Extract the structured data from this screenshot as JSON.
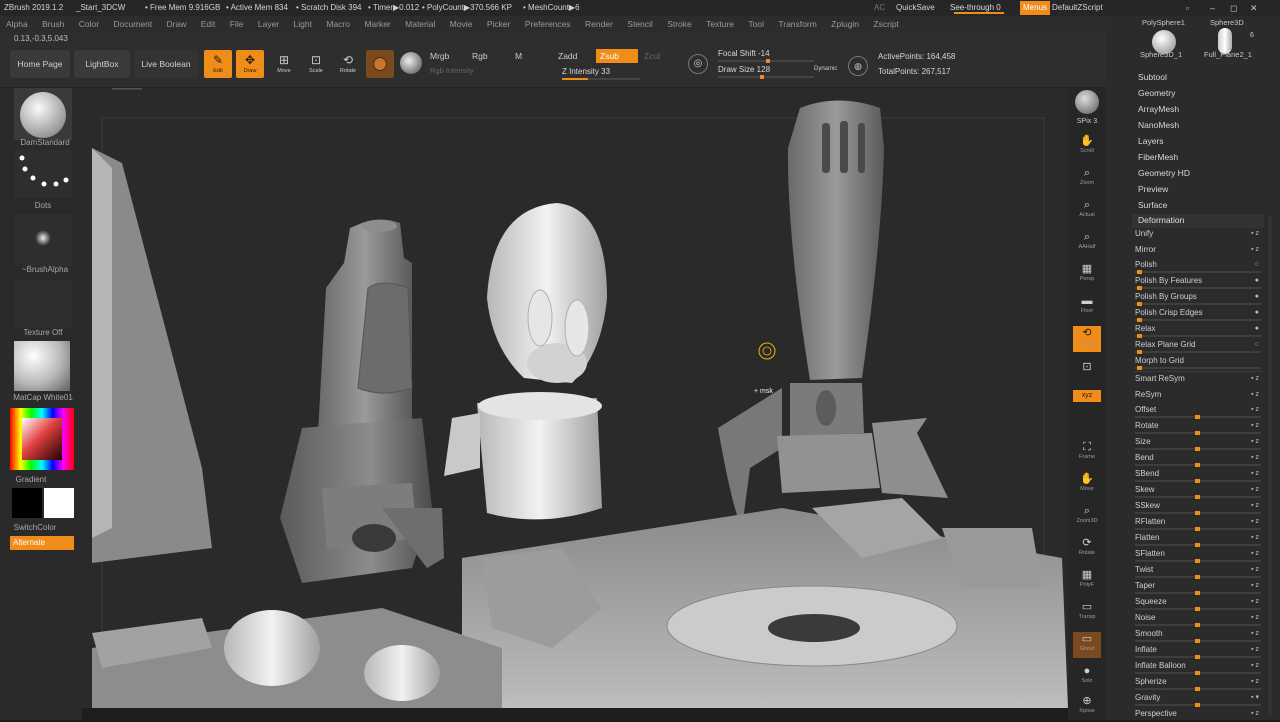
{
  "titlebar": {
    "app": "ZBrush 2019.1.2",
    "doc": "_Start_3DCW",
    "free_mem": "• Free Mem 9.916GB",
    "active_mem": "• Active Mem 834",
    "scratch": "• Scratch Disk 394",
    "timer": "• Timer▶0.012",
    "polycount": "• PolyCount▶370.566 KP",
    "meshcount": "• MeshCount▶6",
    "ac": "AC",
    "quicksave": "QuickSave",
    "seethrough": "See-through  0",
    "menus": "Menus",
    "script": "DefaultZScript"
  },
  "menus": [
    "Alpha",
    "Brush",
    "Color",
    "Document",
    "Draw",
    "Edit",
    "File",
    "Layer",
    "Light",
    "Macro",
    "Marker",
    "Material",
    "Movie",
    "Picker",
    "Preferences",
    "Render",
    "Stencil",
    "Stroke",
    "Texture",
    "Tool",
    "Transform",
    "Zplugin",
    "Zscript"
  ],
  "coords": "0.13,-0.3,5.043",
  "toolbar": {
    "home": "Home Page",
    "lightbox": "LightBox",
    "live_boolean": "Live Boolean",
    "edit": "Edit",
    "draw": "Draw",
    "move": "Move",
    "scale": "Scale",
    "rotate": "Rotate",
    "mrgb": "Mrgb",
    "rgb": "Rgb",
    "m": "M",
    "rgb_intensity": "Rgb Intensity",
    "zadd": "Zadd",
    "zsub": "Zsub",
    "zcut": "Zcut",
    "z_intensity": "Z Intensity 33",
    "z_intensity_value": 0.33,
    "focal_shift": "Focal Shift -14",
    "draw_size": "Draw Size 128",
    "dynamic": "Dynamic",
    "active_points": "ActivePoints: 164,458",
    "total_points": "TotalPoints: 267,517"
  },
  "leftshelf": {
    "brush": "DamStandard",
    "stroke": "Dots",
    "alpha": "~BrushAlpha",
    "texture": "Texture Off",
    "material": "MatCap White01",
    "gradient": "Gradient",
    "switchcolor": "SwitchColor",
    "alternate": "Alternate"
  },
  "rightshelf": [
    {
      "icon": "bpr-icon",
      "glyph": "BPR",
      "label": ""
    },
    {
      "icon": "spix-icon",
      "glyph": "",
      "label": "SPix 3"
    },
    {
      "icon": "scroll-icon",
      "glyph": "✋",
      "label": "Scroll"
    },
    {
      "icon": "zoom-icon",
      "glyph": "⌕",
      "label": "Zoom"
    },
    {
      "icon": "actual-icon",
      "glyph": "⌕",
      "label": "Actual"
    },
    {
      "icon": "aahalf-icon",
      "glyph": "⌕",
      "label": "AAHalf"
    },
    {
      "icon": "persp-icon",
      "glyph": "▦",
      "label": "Persp"
    },
    {
      "icon": "floor-icon",
      "glyph": "▬",
      "label": "Floor"
    },
    {
      "icon": "local-icon",
      "glyph": "⟲",
      "label": "L.Sym"
    },
    {
      "icon": "lock-icon",
      "glyph": "🔒",
      "label": ""
    },
    {
      "icon": "xyz-icon",
      "glyph": "xyz",
      "label": ""
    },
    {
      "icon": "frame-icon",
      "glyph": "⛶",
      "label": "Frame"
    },
    {
      "icon": "move-icon",
      "glyph": "✋",
      "label": "Move"
    },
    {
      "icon": "zoom3d-icon",
      "glyph": "⌕",
      "label": "Zoom3D"
    },
    {
      "icon": "rotate-icon",
      "glyph": "⟳",
      "label": "Rotate"
    },
    {
      "icon": "polyf-icon",
      "glyph": "▦",
      "label": "PolyF"
    },
    {
      "icon": "transp-icon",
      "glyph": "▭",
      "label": "Transp"
    },
    {
      "icon": "ghost-icon",
      "glyph": "▭",
      "label": "Ghost"
    },
    {
      "icon": "solo-icon",
      "glyph": "●",
      "label": "Solo"
    },
    {
      "icon": "xpose-icon",
      "glyph": "⊕",
      "label": "Xpose"
    }
  ],
  "palette": {
    "thumbs": [
      "PolySphere1",
      "Sphere3D",
      "Sphere3D_1",
      "Full_Plane2_1"
    ],
    "thumb_count": "6",
    "sections": [
      "Subtool",
      "Geometry",
      "ArrayMesh",
      "NanoMesh",
      "Layers",
      "FiberMesh",
      "Geometry HD",
      "Preview",
      "Surface",
      "Deformation"
    ],
    "deformation": [
      "Unify",
      "Mirror",
      "Polish",
      "Polish By Features",
      "Polish By Groups",
      "Polish Crisp Edges",
      "Relax",
      "Relax Plane Grid",
      "Morph to Grid",
      "Smart ReSym",
      "ReSym",
      "Offset",
      "Rotate",
      "Size",
      "Bend",
      "SBend",
      "Skew",
      "SSkew",
      "RFlatten",
      "Flatten",
      "SFlatten",
      "Twist",
      "Taper",
      "Squeeze",
      "Noise",
      "Smooth",
      "Inflate",
      "Inflate Balloon",
      "Spherize",
      "Gravity",
      "Perspective"
    ]
  },
  "colors": {
    "accent": "#f08c1a",
    "panel": "#2b2b2b",
    "canvas": "#2a2a2a"
  }
}
